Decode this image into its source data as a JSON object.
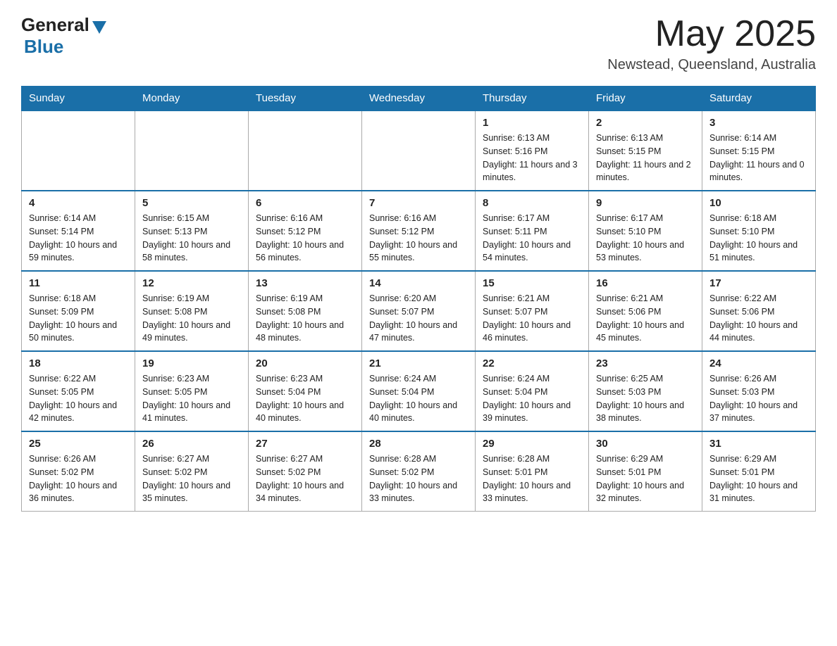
{
  "header": {
    "logo_general": "General",
    "logo_blue": "Blue",
    "month_title": "May 2025",
    "location": "Newstead, Queensland, Australia"
  },
  "days_of_week": [
    "Sunday",
    "Monday",
    "Tuesday",
    "Wednesday",
    "Thursday",
    "Friday",
    "Saturday"
  ],
  "weeks": [
    [
      {
        "day": "",
        "info": ""
      },
      {
        "day": "",
        "info": ""
      },
      {
        "day": "",
        "info": ""
      },
      {
        "day": "",
        "info": ""
      },
      {
        "day": "1",
        "info": "Sunrise: 6:13 AM\nSunset: 5:16 PM\nDaylight: 11 hours and 3 minutes."
      },
      {
        "day": "2",
        "info": "Sunrise: 6:13 AM\nSunset: 5:15 PM\nDaylight: 11 hours and 2 minutes."
      },
      {
        "day": "3",
        "info": "Sunrise: 6:14 AM\nSunset: 5:15 PM\nDaylight: 11 hours and 0 minutes."
      }
    ],
    [
      {
        "day": "4",
        "info": "Sunrise: 6:14 AM\nSunset: 5:14 PM\nDaylight: 10 hours and 59 minutes."
      },
      {
        "day": "5",
        "info": "Sunrise: 6:15 AM\nSunset: 5:13 PM\nDaylight: 10 hours and 58 minutes."
      },
      {
        "day": "6",
        "info": "Sunrise: 6:16 AM\nSunset: 5:12 PM\nDaylight: 10 hours and 56 minutes."
      },
      {
        "day": "7",
        "info": "Sunrise: 6:16 AM\nSunset: 5:12 PM\nDaylight: 10 hours and 55 minutes."
      },
      {
        "day": "8",
        "info": "Sunrise: 6:17 AM\nSunset: 5:11 PM\nDaylight: 10 hours and 54 minutes."
      },
      {
        "day": "9",
        "info": "Sunrise: 6:17 AM\nSunset: 5:10 PM\nDaylight: 10 hours and 53 minutes."
      },
      {
        "day": "10",
        "info": "Sunrise: 6:18 AM\nSunset: 5:10 PM\nDaylight: 10 hours and 51 minutes."
      }
    ],
    [
      {
        "day": "11",
        "info": "Sunrise: 6:18 AM\nSunset: 5:09 PM\nDaylight: 10 hours and 50 minutes."
      },
      {
        "day": "12",
        "info": "Sunrise: 6:19 AM\nSunset: 5:08 PM\nDaylight: 10 hours and 49 minutes."
      },
      {
        "day": "13",
        "info": "Sunrise: 6:19 AM\nSunset: 5:08 PM\nDaylight: 10 hours and 48 minutes."
      },
      {
        "day": "14",
        "info": "Sunrise: 6:20 AM\nSunset: 5:07 PM\nDaylight: 10 hours and 47 minutes."
      },
      {
        "day": "15",
        "info": "Sunrise: 6:21 AM\nSunset: 5:07 PM\nDaylight: 10 hours and 46 minutes."
      },
      {
        "day": "16",
        "info": "Sunrise: 6:21 AM\nSunset: 5:06 PM\nDaylight: 10 hours and 45 minutes."
      },
      {
        "day": "17",
        "info": "Sunrise: 6:22 AM\nSunset: 5:06 PM\nDaylight: 10 hours and 44 minutes."
      }
    ],
    [
      {
        "day": "18",
        "info": "Sunrise: 6:22 AM\nSunset: 5:05 PM\nDaylight: 10 hours and 42 minutes."
      },
      {
        "day": "19",
        "info": "Sunrise: 6:23 AM\nSunset: 5:05 PM\nDaylight: 10 hours and 41 minutes."
      },
      {
        "day": "20",
        "info": "Sunrise: 6:23 AM\nSunset: 5:04 PM\nDaylight: 10 hours and 40 minutes."
      },
      {
        "day": "21",
        "info": "Sunrise: 6:24 AM\nSunset: 5:04 PM\nDaylight: 10 hours and 40 minutes."
      },
      {
        "day": "22",
        "info": "Sunrise: 6:24 AM\nSunset: 5:04 PM\nDaylight: 10 hours and 39 minutes."
      },
      {
        "day": "23",
        "info": "Sunrise: 6:25 AM\nSunset: 5:03 PM\nDaylight: 10 hours and 38 minutes."
      },
      {
        "day": "24",
        "info": "Sunrise: 6:26 AM\nSunset: 5:03 PM\nDaylight: 10 hours and 37 minutes."
      }
    ],
    [
      {
        "day": "25",
        "info": "Sunrise: 6:26 AM\nSunset: 5:02 PM\nDaylight: 10 hours and 36 minutes."
      },
      {
        "day": "26",
        "info": "Sunrise: 6:27 AM\nSunset: 5:02 PM\nDaylight: 10 hours and 35 minutes."
      },
      {
        "day": "27",
        "info": "Sunrise: 6:27 AM\nSunset: 5:02 PM\nDaylight: 10 hours and 34 minutes."
      },
      {
        "day": "28",
        "info": "Sunrise: 6:28 AM\nSunset: 5:02 PM\nDaylight: 10 hours and 33 minutes."
      },
      {
        "day": "29",
        "info": "Sunrise: 6:28 AM\nSunset: 5:01 PM\nDaylight: 10 hours and 33 minutes."
      },
      {
        "day": "30",
        "info": "Sunrise: 6:29 AM\nSunset: 5:01 PM\nDaylight: 10 hours and 32 minutes."
      },
      {
        "day": "31",
        "info": "Sunrise: 6:29 AM\nSunset: 5:01 PM\nDaylight: 10 hours and 31 minutes."
      }
    ]
  ]
}
